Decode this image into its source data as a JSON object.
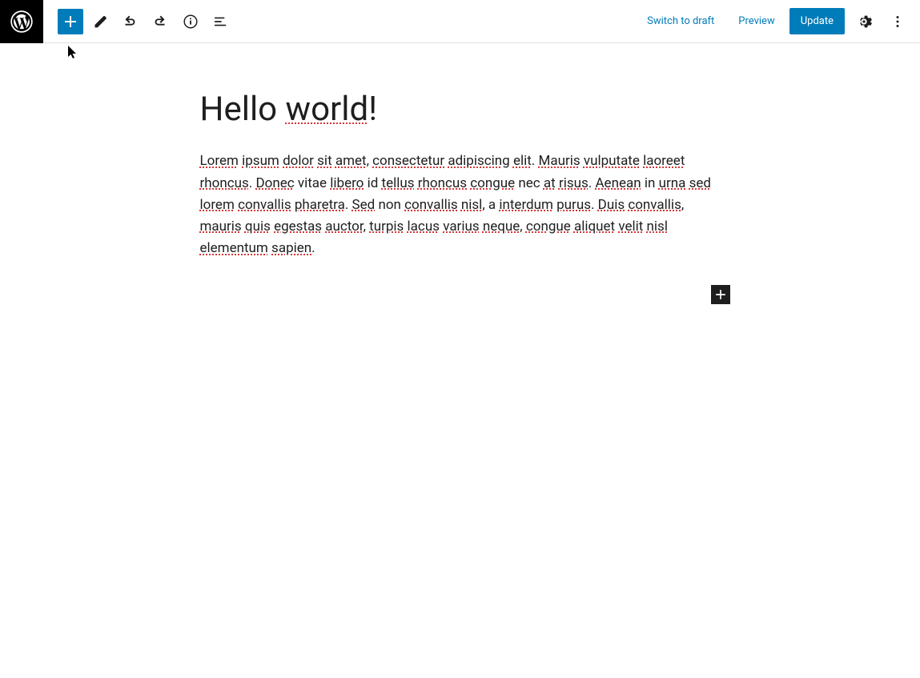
{
  "header": {
    "switch_to_draft": "Switch to draft",
    "preview": "Preview",
    "update": "Update"
  },
  "post": {
    "title_plain": "Hello ",
    "title_spell": "world",
    "title_tail": "!",
    "body_segments": [
      {
        "t": "Lorem",
        "s": true
      },
      {
        "t": " "
      },
      {
        "t": "ipsum",
        "s": true
      },
      {
        "t": " "
      },
      {
        "t": "dolor",
        "s": true
      },
      {
        "t": " "
      },
      {
        "t": "sit",
        "s": true
      },
      {
        "t": " "
      },
      {
        "t": "amet",
        "s": true
      },
      {
        "t": ", "
      },
      {
        "t": "consectetur",
        "s": true
      },
      {
        "t": " "
      },
      {
        "t": "adipiscing",
        "s": true
      },
      {
        "t": " "
      },
      {
        "t": "elit",
        "s": true
      },
      {
        "t": ". "
      },
      {
        "t": "Mauris",
        "s": true
      },
      {
        "t": " "
      },
      {
        "t": "vulputate",
        "s": true
      },
      {
        "t": " "
      },
      {
        "t": "laoreet",
        "s": true
      },
      {
        "t": " "
      },
      {
        "t": "rhoncus",
        "s": true
      },
      {
        "t": ". "
      },
      {
        "t": "Donec",
        "s": true
      },
      {
        "t": " vitae "
      },
      {
        "t": "libero",
        "s": true
      },
      {
        "t": " id "
      },
      {
        "t": "tellus",
        "s": true
      },
      {
        "t": " "
      },
      {
        "t": "rhoncus",
        "s": true
      },
      {
        "t": " "
      },
      {
        "t": "congue",
        "s": true
      },
      {
        "t": " nec "
      },
      {
        "t": "at",
        "s": true
      },
      {
        "t": " "
      },
      {
        "t": "risus",
        "s": true
      },
      {
        "t": ". "
      },
      {
        "t": "Aenean",
        "s": true
      },
      {
        "t": " in "
      },
      {
        "t": "urna",
        "s": true
      },
      {
        "t": " "
      },
      {
        "t": "sed",
        "s": true
      },
      {
        "t": " "
      },
      {
        "t": "lorem",
        "s": true
      },
      {
        "t": " "
      },
      {
        "t": "convallis",
        "s": true
      },
      {
        "t": " "
      },
      {
        "t": "pharetra",
        "s": true
      },
      {
        "t": ". "
      },
      {
        "t": "Sed",
        "s": true
      },
      {
        "t": " non "
      },
      {
        "t": "convallis",
        "s": true
      },
      {
        "t": " "
      },
      {
        "t": "nisl",
        "s": true
      },
      {
        "t": ", a "
      },
      {
        "t": "interdum",
        "s": true
      },
      {
        "t": " "
      },
      {
        "t": "purus",
        "s": true
      },
      {
        "t": ". "
      },
      {
        "t": "Duis",
        "s": true
      },
      {
        "t": " "
      },
      {
        "t": "convallis",
        "s": true
      },
      {
        "t": ", "
      },
      {
        "t": "mauris",
        "s": true
      },
      {
        "t": " "
      },
      {
        "t": "quis",
        "s": true
      },
      {
        "t": " "
      },
      {
        "t": "egestas",
        "s": true
      },
      {
        "t": " "
      },
      {
        "t": "auctor",
        "s": true
      },
      {
        "t": ", "
      },
      {
        "t": "turpis",
        "s": true
      },
      {
        "t": " "
      },
      {
        "t": "lacus",
        "s": true
      },
      {
        "t": " "
      },
      {
        "t": "varius",
        "s": true
      },
      {
        "t": " "
      },
      {
        "t": "neque",
        "s": true
      },
      {
        "t": ", "
      },
      {
        "t": "congue",
        "s": true
      },
      {
        "t": " "
      },
      {
        "t": "aliquet",
        "s": true
      },
      {
        "t": " "
      },
      {
        "t": "velit",
        "s": true
      },
      {
        "t": " "
      },
      {
        "t": "nisl",
        "s": true
      },
      {
        "t": " "
      },
      {
        "t": "elementum",
        "s": true
      },
      {
        "t": " "
      },
      {
        "t": "sapien",
        "s": true
      },
      {
        "t": "."
      }
    ]
  }
}
